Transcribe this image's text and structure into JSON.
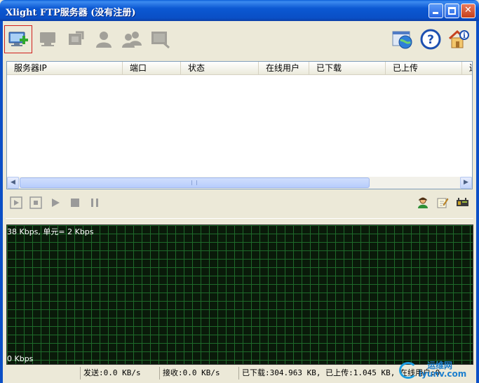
{
  "window": {
    "title": "Xlight FTP服务器 (没有注册)",
    "minimize_icon": "minimize-icon",
    "maximize_icon": "maximize-icon",
    "close_icon": "close-icon"
  },
  "toolbar": {
    "items": [
      {
        "icon": "add-server-icon",
        "state": "active"
      },
      {
        "icon": "server-icon",
        "state": "disabled"
      },
      {
        "icon": "edit-server-icon",
        "state": "disabled"
      },
      {
        "icon": "user-icon",
        "state": "disabled"
      },
      {
        "icon": "users-icon",
        "state": "disabled"
      },
      {
        "icon": "monitor-icon",
        "state": "disabled"
      }
    ],
    "right_items": [
      {
        "icon": "web-globe-icon"
      },
      {
        "icon": "help-icon"
      },
      {
        "icon": "home-info-icon"
      }
    ]
  },
  "server_list": {
    "columns": [
      "服务器IP",
      "端口",
      "状态",
      "在线用户",
      "已下载",
      "已上传",
      "连"
    ],
    "rows": []
  },
  "controls": {
    "left": [
      "step-icon",
      "stop-square-icon",
      "play-icon",
      "stop-icon",
      "pause-icon"
    ],
    "right": [
      "user-online-icon",
      "notepad-icon",
      "log-icon"
    ]
  },
  "graph": {
    "top_label": "38 Kbps, 单元= 2 Kbps",
    "bottom_label": "0 Kbps"
  },
  "status": {
    "panel_empty": "",
    "send": "发送:0.0 KB/s",
    "receive": "接收:0.0 KB/s",
    "totals": "已下载:304.963 KB, 已上传:1.045 KB, 在线用户:0"
  },
  "watermark": {
    "text": "运维网",
    "sub": "iyunv.com"
  },
  "colors": {
    "titlebar": "#0b58d2",
    "graph_bg": "#0a1a0a",
    "graph_grid": "#1e6a2a",
    "active_border": "#d0201c"
  }
}
